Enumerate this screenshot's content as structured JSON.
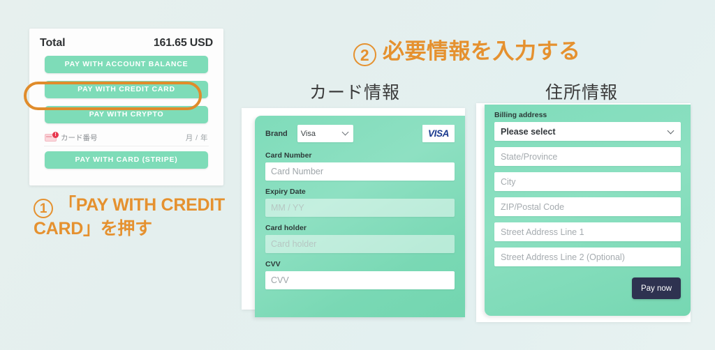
{
  "checkout": {
    "total_label": "Total",
    "total_value": "161.65 USD",
    "buttons": [
      {
        "label": "PAY WITH ACCOUNT BALANCE",
        "name": "pay-with-account-balance-button"
      },
      {
        "label": "PAY WITH CREDIT CARD",
        "name": "pay-with-credit-card-button"
      },
      {
        "label": "PAY WITH CRYPTO",
        "name": "pay-with-crypto-button"
      },
      {
        "label": "PAY WITH CARD (STRIPE)",
        "name": "pay-with-card-stripe-button"
      }
    ],
    "card_number_row": {
      "label": "カード番号",
      "expiry_hint": "月 / 年",
      "badge": "!"
    }
  },
  "annotations": {
    "step1": {
      "number": "①",
      "text": "「PAY WITH CREDIT CARD」を押す"
    },
    "step2": {
      "number": "②",
      "text": "必要情報を入力する"
    },
    "card_section_heading": "カード情報",
    "address_section_heading": "住所情報"
  },
  "card_form": {
    "brand_label": "Brand",
    "brand_value": "Visa",
    "brand_logo_text": "VISA",
    "fields": [
      {
        "label": "Card Number",
        "placeholder": "Card Number",
        "value": "",
        "name": "card-number-input",
        "translucent": false
      },
      {
        "label": "Expiry Date",
        "placeholder": "MM / YY",
        "value": "",
        "name": "expiry-date-input",
        "translucent": true
      },
      {
        "label": "Card holder",
        "placeholder": "Card holder",
        "value": "",
        "name": "card-holder-input",
        "translucent": true
      },
      {
        "label": "CVV",
        "placeholder": "CVV",
        "value": "",
        "name": "cvv-input",
        "translucent": false
      }
    ]
  },
  "billing_form": {
    "title": "Billing address",
    "country_selected": "Please select",
    "fields": [
      {
        "placeholder": "State/Province",
        "value": "",
        "name": "state-province-input"
      },
      {
        "placeholder": "City",
        "value": "",
        "name": "city-input"
      },
      {
        "placeholder": "ZIP/Postal Code",
        "value": "",
        "name": "zip-postal-code-input"
      },
      {
        "placeholder": "Street Address Line 1",
        "value": "",
        "name": "street-address-line-1-input"
      },
      {
        "placeholder": "Street Address Line 2 (Optional)",
        "value": "",
        "name": "street-address-line-2-input"
      }
    ],
    "pay_now_label": "Pay now"
  },
  "colors": {
    "mint": "#7edcb8",
    "accent_orange": "#e5912f",
    "navy": "#2e3250",
    "background": "#e6f0ef",
    "visa_blue": "#1a3a8f",
    "error_red": "#e8384f"
  }
}
